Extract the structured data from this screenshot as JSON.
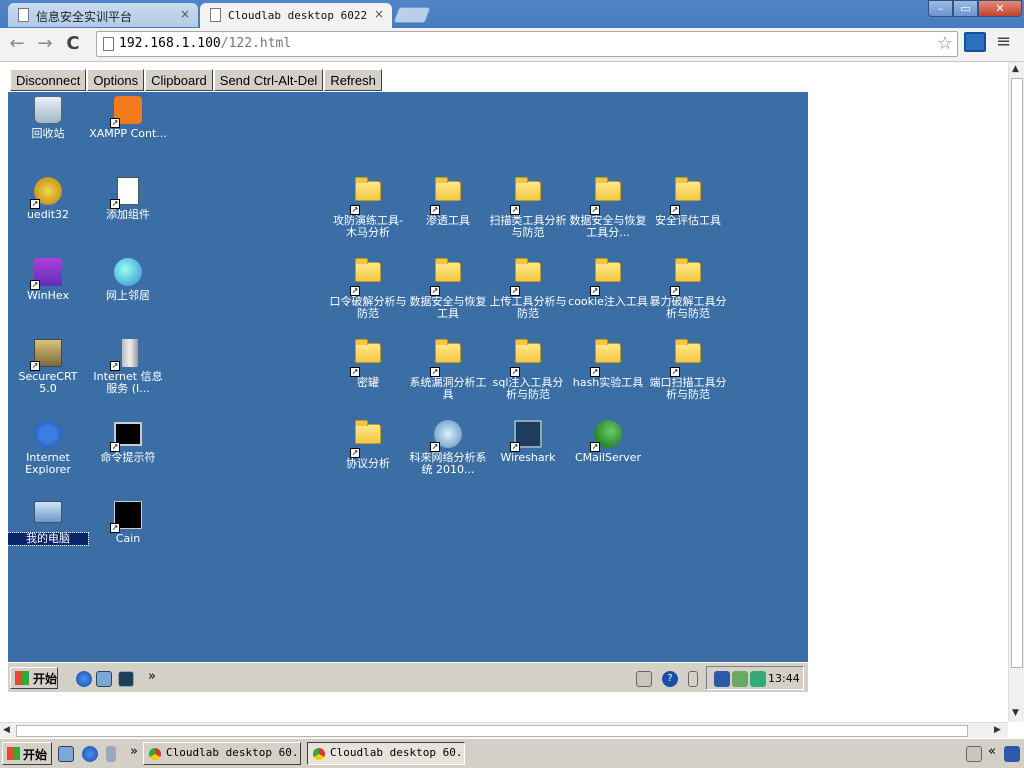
{
  "browser": {
    "tabs": [
      {
        "title": "信息安全实训平台",
        "close": "×"
      },
      {
        "title": "Cloudlab desktop 6022",
        "close": "×"
      }
    ],
    "window_controls": {
      "minimize": "–",
      "maximize": "▭",
      "close": "✕"
    },
    "url_host": "192.168.1.100",
    "url_path": "/122.html",
    "icons": {
      "back": "←",
      "forward": "→",
      "reload": "C",
      "star": "☆",
      "menu": "≡"
    }
  },
  "vnc_toolbar": [
    "Disconnect",
    "Options",
    "Clipboard",
    "Send Ctrl-Alt-Del",
    "Refresh"
  ],
  "remote_desktop": {
    "background": "#3a6ea5",
    "icons_left": [
      {
        "label": "回收站",
        "icon": "recycle-bin"
      },
      {
        "label": "XAMPP Cont...",
        "icon": "xampp"
      },
      {
        "label": "uedit32",
        "icon": "ultraedit"
      },
      {
        "label": "添加组件",
        "icon": "add-component"
      },
      {
        "label": "WinHex",
        "icon": "winhex"
      },
      {
        "label": "网上邻居",
        "icon": "network"
      },
      {
        "label": "SecureCRT 5.0",
        "icon": "securecrt"
      },
      {
        "label": "Internet 信息服务 (I...",
        "icon": "iis"
      },
      {
        "label": "Internet Explorer",
        "icon": "ie"
      },
      {
        "label": "命令提示符",
        "icon": "cmd"
      },
      {
        "label": "我的电脑",
        "icon": "my-computer"
      },
      {
        "label": "Cain",
        "icon": "cain"
      }
    ],
    "folders": [
      {
        "label": "攻防演练工具-木马分析"
      },
      {
        "label": "渗透工具"
      },
      {
        "label": "扫描类工具分析与防范"
      },
      {
        "label": "数据安全与恢复工具分..."
      },
      {
        "label": "安全评估工具"
      },
      {
        "label": "口令破解分析与防范"
      },
      {
        "label": "数据安全与恢复工具"
      },
      {
        "label": "上传工具分析与防范"
      },
      {
        "label": "cookie注入工具"
      },
      {
        "label": "暴力破解工具分析与防范"
      },
      {
        "label": "密罐"
      },
      {
        "label": "系统漏洞分析工具"
      },
      {
        "label": "sql注入工具分析与防范"
      },
      {
        "label": "hash实验工具"
      },
      {
        "label": "端口扫描工具分析与防范"
      },
      {
        "label": "协议分析"
      }
    ],
    "apps": [
      {
        "label": "科来网络分析系统 2010...",
        "icon": "colasoft"
      },
      {
        "label": "Wireshark",
        "icon": "wireshark"
      },
      {
        "label": "CMailServer",
        "icon": "cmailserver"
      }
    ],
    "taskbar": {
      "start": "开始",
      "chevron": "»",
      "clock": "13:44",
      "help": "?"
    }
  },
  "os_taskbar": {
    "start": "开始",
    "chevron": "»",
    "tasks": [
      "Cloudlab desktop 60...",
      "Cloudlab desktop 60..."
    ],
    "right_chevron": "«"
  }
}
